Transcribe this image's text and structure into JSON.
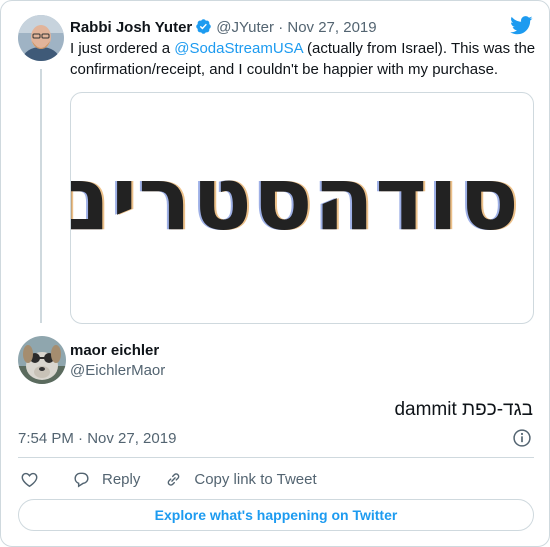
{
  "quoted_tweet": {
    "author_name": "Rabbi Josh Yuter",
    "handle": "@JYuter",
    "separator": "·",
    "date": "Nov 27, 2019",
    "text_before": "I just ordered a ",
    "mention": "@SodaStreamUSA",
    "text_after": " (actually from Israel). This was the confirmation/receipt, and I couldn't be happier with my purchase.",
    "media_text": "סודהסטרים"
  },
  "reply_tweet": {
    "author_name": "maor eichler",
    "handle": "@EichlerMaor",
    "text": "בגד-כפת dammit",
    "timestamp": "7:54 PM · Nov 27, 2019"
  },
  "actions": {
    "reply_label": "Reply",
    "copy_link_label": "Copy link to Tweet"
  },
  "explore_label": "Explore what's happening on Twitter",
  "icons": {
    "brand": "twitter-bird-icon",
    "verified": "verified-badge-icon",
    "like": "heart-icon",
    "reply": "reply-bubble-icon",
    "copy": "link-icon",
    "info": "info-icon"
  },
  "colors": {
    "accent": "#1d9bf0",
    "border": "#cfd9de",
    "secondary_text": "#536471"
  }
}
